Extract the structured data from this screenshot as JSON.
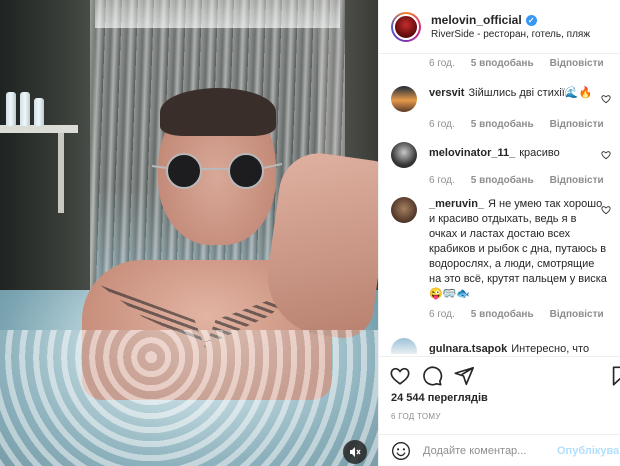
{
  "header": {
    "username": "melovin_official",
    "location": "RiverSide - ресторан, готель, пляж"
  },
  "top_meta": {
    "time": "6 год.",
    "likes": "5 вподобань",
    "reply": "Відповісти"
  },
  "comments": [
    {
      "user": "versvit",
      "text": "Зійшлись дві стихії🌊🔥",
      "time": "6 год.",
      "likes": "5 вподобань",
      "reply": "Відповісти"
    },
    {
      "user": "melovinator_11_",
      "text": "красиво",
      "time": "6 год.",
      "likes": "5 вподобань",
      "reply": "Відповісти"
    },
    {
      "user": "_meruvin_",
      "text": "Я не умею так хорошо и красиво отдыхать, ведь я в очках и ластах достаю всех крабиков и рыбок с дна, путаюсь в водорослях, а люди, смотрящие на это всё, крутят пальцем у виска😜🥽🐟",
      "time": "6 год.",
      "likes": "5 вподобань",
      "reply": "Відповісти"
    },
    {
      "user": "gulnara.tsapok",
      "text": "Интересно, что",
      "time": "",
      "likes": "",
      "reply": ""
    }
  ],
  "views": "24 544 переглядів",
  "posted": "6 ГОД ТОМУ",
  "add_comment": {
    "placeholder": "Додайте коментар...",
    "publish": "Опублікува"
  },
  "icons": [
    "heart-icon",
    "comment-icon",
    "share-icon",
    "bookmark-icon",
    "emoji-icon",
    "mute-icon"
  ],
  "colors": {
    "link_blue": "#b2dffc",
    "verified": "#3897f0",
    "muted_text": "#8e8e8e"
  }
}
